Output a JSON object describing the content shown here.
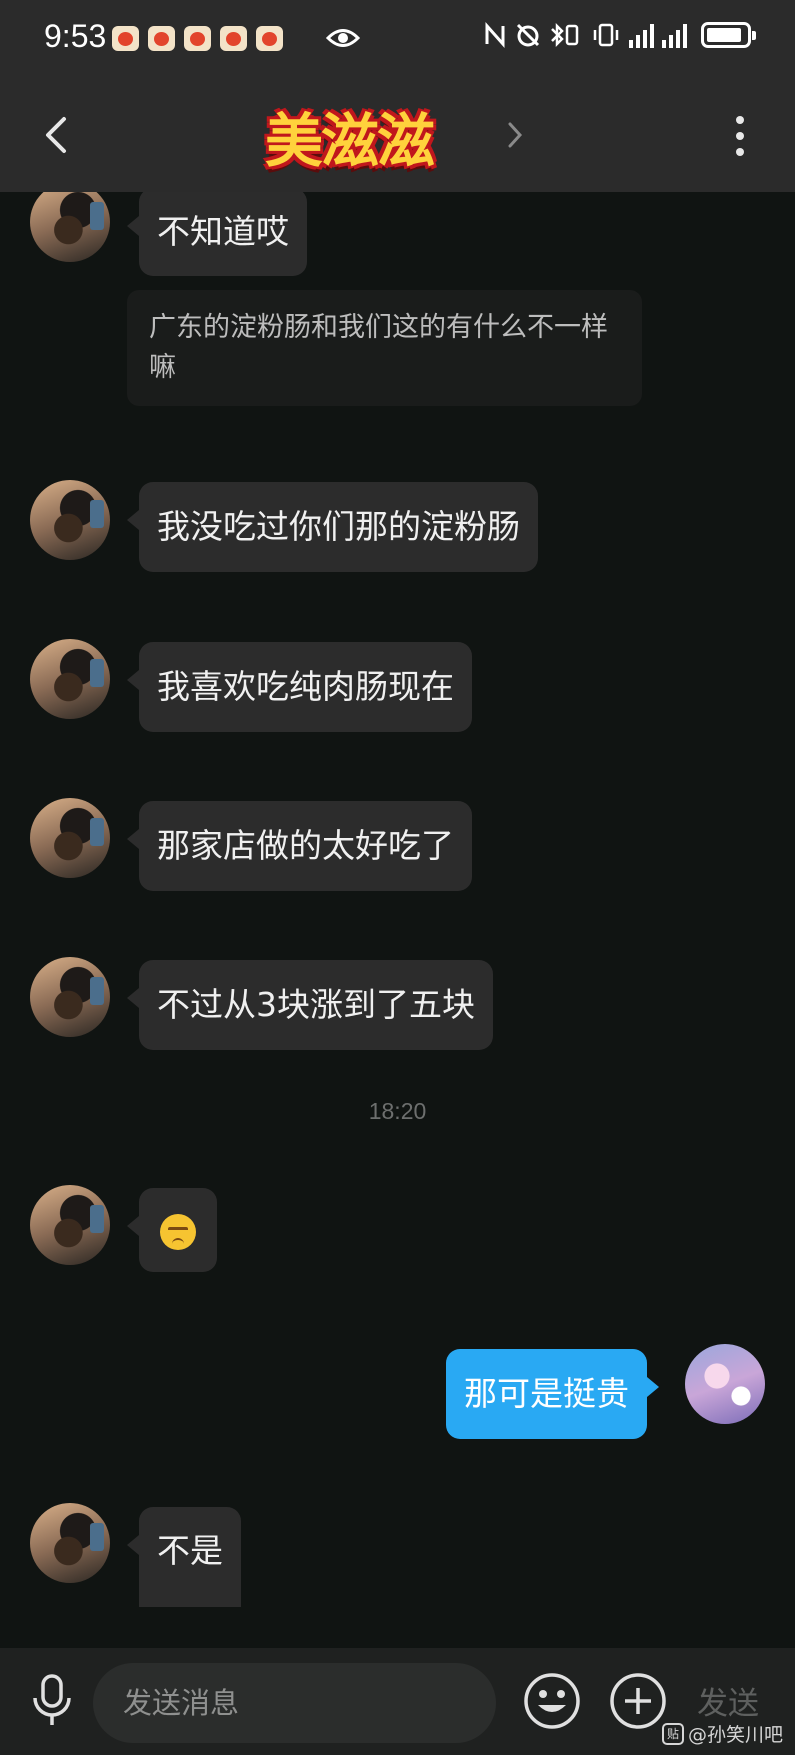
{
  "status_bar": {
    "time": "9:53"
  },
  "header": {
    "title": "美滋滋"
  },
  "messages": [
    {
      "side": "left",
      "text": "不知道哎"
    },
    {
      "side": "quote",
      "text": "广东的淀粉肠和我们这的有什么不一样嘛"
    },
    {
      "side": "left",
      "text": "我没吃过你们那的淀粉肠"
    },
    {
      "side": "left",
      "text": "我喜欢吃纯肉肠现在"
    },
    {
      "side": "left",
      "text": "那家店做的太好吃了"
    },
    {
      "side": "left",
      "text": "不过从3块涨到了五块"
    },
    {
      "side": "time",
      "text": "18:20"
    },
    {
      "side": "left",
      "emoji": "pensive-face"
    },
    {
      "side": "right",
      "text": "那可是挺贵"
    },
    {
      "side": "left",
      "text": "不是"
    }
  ],
  "input_bar": {
    "placeholder": "发送消息",
    "send_label": "发送"
  },
  "watermark": {
    "badge": "贴",
    "text": "@孙笑川吧"
  },
  "colors": {
    "background": "#101412",
    "bubble_left": "#2c2c2c",
    "bubble_right": "#29a9f3",
    "bar": "#2b2b2b"
  }
}
